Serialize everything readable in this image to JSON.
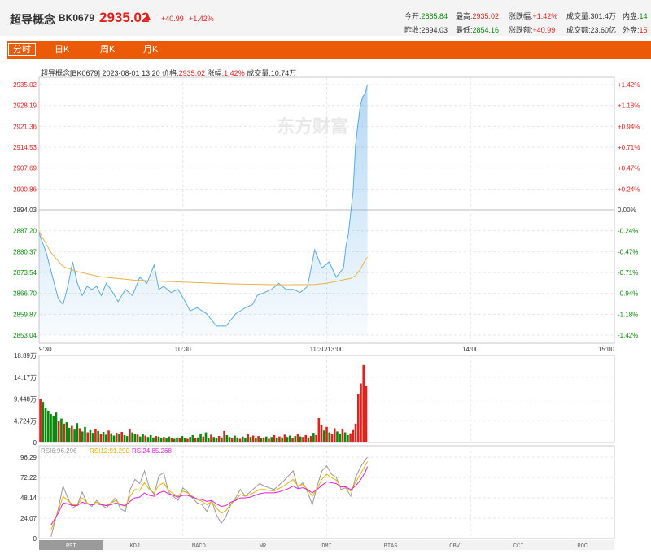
{
  "header": {
    "name": "超导概念",
    "code": "BK0679",
    "price": "2935.02",
    "arrow": "▲",
    "change": "+40.99",
    "change_pct": "+1.42%",
    "quotes": [
      {
        "label": "今开:",
        "value": "2885.84",
        "color": "green"
      },
      {
        "label": "最高:",
        "value": "2935.02",
        "color": "red"
      },
      {
        "label": "涨跌幅:",
        "value": "+1.42%",
        "color": "red"
      },
      {
        "label": "成交量:",
        "value": "301.4万",
        "color": "none"
      },
      {
        "label": "内盘:",
        "value": "14",
        "color": "green"
      },
      {
        "label": "昨收:",
        "value": "2894.03",
        "color": "none"
      },
      {
        "label": "最低:",
        "value": "2854.16",
        "color": "green"
      },
      {
        "label": "涨跌额:",
        "value": "+40.99",
        "color": "red"
      },
      {
        "label": "成交额:",
        "value": "23.60亿",
        "color": "none"
      },
      {
        "label": "外盘:",
        "value": "15",
        "color": "red"
      }
    ]
  },
  "tabs": [
    "分时",
    "日K",
    "周K",
    "月K"
  ],
  "info": {
    "text_prefix": "超导概念[BK0679]   2023-08-01 13:20   价格:",
    "price": "2935.02",
    "change_label": "涨幅:",
    "change_pct": "1.42%",
    "volume_label": "成交量:",
    "volume": "10.74万"
  },
  "watermark": "东方财富",
  "colors": {
    "up": "#e0221f",
    "down": "#0a8a0a",
    "price_line": "#5aa9e6",
    "avg_line": "#e7b24a",
    "rsi6": "#999999",
    "rsi12": "#e8b000",
    "rsi24": "#dd22dd",
    "tab_bg": "#ea5a07"
  },
  "chart_data": [
    {
      "type": "line",
      "title": "",
      "y_ticks": [
        "2935.02",
        "2928.19",
        "2921.36",
        "2914.53",
        "2907.69",
        "2900.86",
        "2894.03",
        "2887.20",
        "2880.37",
        "2873.54",
        "2866.70",
        "2859.87",
        "2853.04"
      ],
      "y_pct_ticks": [
        "+1.42%",
        "+1.18%",
        "+0.94%",
        "+0.71%",
        "+0.47%",
        "+0.24%",
        "0.00%",
        "-0.24%",
        "-0.47%",
        "-0.71%",
        "-0.94%",
        "-1.18%",
        "-1.42%"
      ],
      "x_ticks": [
        "9:30",
        "10:30",
        "11:30/13:00",
        "14:00",
        "15:00"
      ],
      "ylim": [
        2853.04,
        2935.02
      ],
      "prev_close": 2894.03,
      "total_minutes": 240,
      "series": [
        {
          "name": "price",
          "x": [
            0,
            3,
            6,
            8,
            10,
            12,
            14,
            16,
            18,
            20,
            22,
            24,
            26,
            28,
            30,
            33,
            36,
            39,
            42,
            45,
            48,
            50,
            52,
            55,
            58,
            61,
            63,
            66,
            70,
            74,
            78,
            82,
            86,
            89,
            91,
            94,
            97,
            100,
            103,
            106,
            109,
            112,
            115,
            118,
            121,
            124,
            127,
            128,
            129,
            131,
            132,
            133,
            134,
            135,
            136,
            137
          ],
          "values": [
            2886.5,
            2880,
            2871,
            2865,
            2863,
            2869,
            2877,
            2870,
            2866,
            2869,
            2868,
            2869,
            2866,
            2870,
            2868,
            2864,
            2868,
            2866,
            2872,
            2870,
            2876,
            2868,
            2869,
            2867,
            2868,
            2864,
            2861,
            2862,
            2860,
            2856,
            2856,
            2860,
            2862,
            2863,
            2866,
            2867,
            2868,
            2870,
            2868,
            2868,
            2867,
            2869,
            2881,
            2875,
            2877,
            2872,
            2875,
            2882,
            2886,
            2900,
            2915,
            2922,
            2928,
            2931,
            2932,
            2935
          ]
        },
        {
          "name": "average",
          "x": [
            0,
            5,
            10,
            15,
            25,
            40,
            60,
            80,
            100,
            115,
            120,
            122,
            124,
            126,
            128,
            130,
            132,
            134,
            136,
            137
          ],
          "values": [
            2887,
            2880,
            2875.5,
            2874,
            2872.2,
            2871,
            2870.4,
            2869.8,
            2869.5,
            2869.6,
            2870,
            2870.3,
            2870.6,
            2871,
            2871.3,
            2871.6,
            2872.5,
            2874.5,
            2877.5,
            2878.5
          ]
        }
      ]
    },
    {
      "type": "bar",
      "title": "",
      "y_ticks": [
        "18.89万",
        "14.17万",
        "9.448万",
        "4.724万",
        "0"
      ],
      "ylim": [
        0,
        18.89
      ],
      "unit": "万",
      "bars": [
        [
          9.5,
          "up"
        ],
        [
          8.8,
          "down"
        ],
        [
          7.6,
          "down"
        ],
        [
          6.9,
          "down"
        ],
        [
          6.2,
          "down"
        ],
        [
          5.7,
          "down"
        ],
        [
          6.5,
          "down"
        ],
        [
          4.6,
          "up"
        ],
        [
          5.2,
          "down"
        ],
        [
          4.1,
          "up"
        ],
        [
          4.4,
          "down"
        ],
        [
          3.2,
          "down"
        ],
        [
          3.6,
          "up"
        ],
        [
          2.8,
          "down"
        ],
        [
          4.2,
          "down"
        ],
        [
          3.1,
          "up"
        ],
        [
          2.4,
          "down"
        ],
        [
          3.4,
          "down"
        ],
        [
          2.2,
          "up"
        ],
        [
          2.7,
          "down"
        ],
        [
          2.1,
          "down"
        ],
        [
          3.0,
          "up"
        ],
        [
          2.5,
          "down"
        ],
        [
          1.9,
          "up"
        ],
        [
          2.3,
          "down"
        ],
        [
          1.7,
          "down"
        ],
        [
          2.6,
          "up"
        ],
        [
          2.0,
          "down"
        ],
        [
          1.5,
          "down"
        ],
        [
          2.1,
          "up"
        ],
        [
          1.8,
          "down"
        ],
        [
          2.3,
          "up"
        ],
        [
          1.6,
          "down"
        ],
        [
          1.4,
          "down"
        ],
        [
          2.9,
          "up"
        ],
        [
          2.2,
          "down"
        ],
        [
          1.9,
          "down"
        ],
        [
          1.7,
          "up"
        ],
        [
          1.3,
          "down"
        ],
        [
          1.8,
          "down"
        ],
        [
          1.5,
          "up"
        ],
        [
          1.2,
          "down"
        ],
        [
          1.6,
          "down"
        ],
        [
          1.1,
          "down"
        ],
        [
          1.4,
          "up"
        ],
        [
          1.3,
          "down"
        ],
        [
          1.0,
          "down"
        ],
        [
          1.2,
          "up"
        ],
        [
          0.9,
          "down"
        ],
        [
          1.3,
          "down"
        ],
        [
          1.0,
          "up"
        ],
        [
          0.8,
          "down"
        ],
        [
          1.1,
          "down"
        ],
        [
          0.9,
          "up"
        ],
        [
          1.4,
          "down"
        ],
        [
          1.0,
          "down"
        ],
        [
          0.8,
          "up"
        ],
        [
          1.2,
          "down"
        ],
        [
          1.6,
          "down"
        ],
        [
          0.9,
          "up"
        ],
        [
          1.1,
          "down"
        ],
        [
          1.9,
          "down"
        ],
        [
          1.3,
          "up"
        ],
        [
          2.2,
          "down"
        ],
        [
          1.0,
          "down"
        ],
        [
          1.7,
          "up"
        ],
        [
          1.2,
          "down"
        ],
        [
          0.9,
          "down"
        ],
        [
          1.4,
          "up"
        ],
        [
          1.1,
          "down"
        ],
        [
          2.5,
          "up"
        ],
        [
          1.6,
          "down"
        ],
        [
          1.2,
          "down"
        ],
        [
          0.9,
          "up"
        ],
        [
          1.5,
          "down"
        ],
        [
          1.1,
          "down"
        ],
        [
          0.8,
          "up"
        ],
        [
          1.3,
          "down"
        ],
        [
          1.0,
          "down"
        ],
        [
          1.8,
          "up"
        ],
        [
          1.2,
          "down"
        ],
        [
          1.5,
          "up"
        ],
        [
          1.0,
          "down"
        ],
        [
          1.4,
          "up"
        ],
        [
          0.9,
          "down"
        ],
        [
          1.1,
          "up"
        ],
        [
          1.3,
          "down"
        ],
        [
          0.8,
          "up"
        ],
        [
          1.2,
          "down"
        ],
        [
          1.6,
          "up"
        ],
        [
          1.0,
          "down"
        ],
        [
          1.3,
          "up"
        ],
        [
          1.1,
          "down"
        ],
        [
          1.7,
          "up"
        ],
        [
          1.2,
          "down"
        ],
        [
          1.5,
          "down"
        ],
        [
          1.0,
          "up"
        ],
        [
          1.4,
          "down"
        ],
        [
          1.9,
          "up"
        ],
        [
          1.3,
          "down"
        ],
        [
          1.2,
          "up"
        ],
        [
          1.6,
          "up"
        ],
        [
          1.1,
          "down"
        ],
        [
          1.4,
          "up"
        ],
        [
          2.1,
          "down"
        ],
        [
          1.6,
          "up"
        ],
        [
          5.3,
          "up"
        ],
        [
          3.9,
          "up"
        ],
        [
          2.6,
          "down"
        ],
        [
          3.4,
          "up"
        ],
        [
          2.2,
          "down"
        ],
        [
          1.9,
          "up"
        ],
        [
          3.1,
          "up"
        ],
        [
          2.4,
          "down"
        ],
        [
          1.8,
          "down"
        ],
        [
          2.9,
          "up"
        ],
        [
          2.2,
          "down"
        ],
        [
          1.6,
          "down"
        ],
        [
          2.0,
          "up"
        ],
        [
          2.7,
          "up"
        ],
        [
          4.1,
          "up"
        ],
        [
          10.6,
          "up"
        ],
        [
          12.8,
          "up"
        ],
        [
          16.8,
          "up"
        ],
        [
          12.2,
          "up"
        ]
      ]
    },
    {
      "type": "line",
      "title": "",
      "legend": [
        "RSI6:96.296",
        "RSI12:91.290",
        "RSI24:85.268"
      ],
      "y_ticks": [
        "96.29",
        "72.22",
        "48.14",
        "24.07",
        "0"
      ],
      "ylim": [
        0,
        96.29
      ],
      "series": [
        {
          "name": "RSI6",
          "x": [
            5,
            8,
            10,
            12,
            14,
            16,
            18,
            20,
            22,
            24,
            26,
            28,
            30,
            32,
            34,
            36,
            38,
            40,
            42,
            44,
            46,
            48,
            50,
            52,
            54,
            56,
            58,
            60,
            62,
            64,
            66,
            68,
            70,
            72,
            74,
            76,
            78,
            80,
            82,
            84,
            86,
            88,
            90,
            92,
            94,
            96,
            98,
            100,
            102,
            104,
            106,
            108,
            110,
            112,
            114,
            116,
            118,
            120,
            122,
            124,
            126,
            128,
            130,
            132,
            134,
            136,
            137
          ],
          "values": [
            2,
            35,
            62,
            48,
            36,
            40,
            55,
            42,
            38,
            45,
            40,
            36,
            42,
            48,
            35,
            32,
            58,
            70,
            65,
            80,
            60,
            52,
            74,
            78,
            55,
            50,
            45,
            60,
            55,
            48,
            42,
            40,
            32,
            45,
            28,
            18,
            26,
            40,
            48,
            58,
            50,
            55,
            60,
            65,
            62,
            60,
            58,
            63,
            68,
            74,
            80,
            60,
            66,
            55,
            40,
            62,
            80,
            86,
            76,
            72,
            58,
            60,
            50,
            72,
            84,
            93,
            96
          ]
        },
        {
          "name": "RSI12",
          "x": [
            5,
            8,
            10,
            12,
            14,
            16,
            18,
            20,
            22,
            24,
            26,
            28,
            30,
            32,
            34,
            36,
            38,
            40,
            42,
            44,
            46,
            48,
            50,
            52,
            54,
            56,
            58,
            60,
            62,
            64,
            66,
            68,
            70,
            72,
            74,
            76,
            78,
            80,
            82,
            84,
            86,
            88,
            90,
            92,
            94,
            96,
            98,
            100,
            102,
            104,
            106,
            108,
            110,
            112,
            114,
            116,
            118,
            120,
            122,
            124,
            126,
            128,
            130,
            132,
            134,
            136,
            137
          ],
          "values": [
            10,
            32,
            50,
            45,
            40,
            40,
            48,
            42,
            40,
            43,
            41,
            39,
            42,
            45,
            40,
            38,
            50,
            58,
            57,
            66,
            58,
            54,
            63,
            66,
            57,
            53,
            50,
            56,
            54,
            50,
            46,
            44,
            40,
            44,
            36,
            30,
            33,
            41,
            46,
            52,
            50,
            52,
            55,
            58,
            58,
            57,
            56,
            59,
            62,
            66,
            70,
            62,
            64,
            58,
            50,
            59,
            70,
            76,
            72,
            69,
            61,
            61,
            56,
            66,
            76,
            86,
            91
          ]
        },
        {
          "name": "RSI24",
          "x": [
            5,
            8,
            10,
            12,
            14,
            16,
            18,
            20,
            22,
            24,
            26,
            28,
            30,
            32,
            34,
            36,
            38,
            40,
            42,
            44,
            46,
            48,
            50,
            52,
            54,
            56,
            58,
            60,
            62,
            64,
            66,
            68,
            70,
            72,
            74,
            76,
            78,
            80,
            82,
            84,
            86,
            88,
            90,
            92,
            94,
            96,
            98,
            100,
            102,
            104,
            106,
            108,
            110,
            112,
            114,
            116,
            118,
            120,
            122,
            124,
            126,
            128,
            130,
            132,
            134,
            136,
            137
          ],
          "values": [
            16,
            30,
            42,
            41,
            39,
            39,
            43,
            41,
            40,
            41,
            40,
            39,
            40,
            42,
            40,
            39,
            44,
            48,
            49,
            54,
            51,
            50,
            54,
            56,
            53,
            51,
            49,
            51,
            51,
            49,
            47,
            46,
            44,
            45,
            41,
            38,
            39,
            43,
            45,
            48,
            48,
            49,
            51,
            53,
            54,
            54,
            54,
            55,
            57,
            59,
            62,
            59,
            60,
            58,
            54,
            58,
            63,
            67,
            66,
            65,
            61,
            61,
            58,
            62,
            69,
            78,
            85
          ]
        }
      ]
    }
  ],
  "indicator_tabs": [
    "RSI",
    "KDJ",
    "MACD",
    "WR",
    "DMI",
    "BIAS",
    "OBV",
    "CCI",
    "ROC"
  ]
}
